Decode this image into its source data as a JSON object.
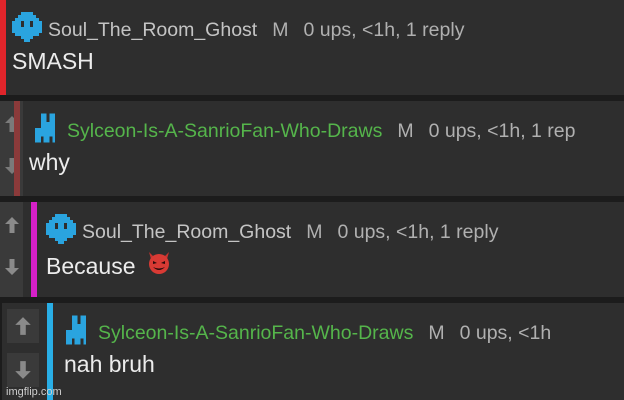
{
  "comments": [
    {
      "user": "Soul_The_Room_Ghost",
      "user_color": "#c4c4c4",
      "mod": "M",
      "meta": "0 ups, <1h, 1 reply",
      "text": "SMASH",
      "bar_color": "#e0252b",
      "avatar": "space-invader-icon"
    },
    {
      "user": "Sylceon-Is-A-SanrioFan-Who-Draws",
      "user_color": "#55b54b",
      "mod": "M",
      "meta": "0 ups, <1h, 1 rep",
      "text": "why",
      "bar_color": "#8b3a3a",
      "avatar": "pixel-creature-icon"
    },
    {
      "user": "Soul_The_Room_Ghost",
      "user_color": "#c4c4c4",
      "mod": "M",
      "meta": "0 ups, <1h, 1 reply",
      "text": "Because",
      "bar_color": "#d520c8",
      "avatar": "space-invader-icon",
      "emoji": "smiling-devil-emoji"
    },
    {
      "user": "Sylceon-Is-A-SanrioFan-Who-Draws",
      "user_color": "#55b54b",
      "mod": "M",
      "meta": "0 ups, <1h",
      "text": "nah bruh",
      "bar_color": "#29aee6",
      "avatar": "pixel-creature-icon"
    }
  ],
  "watermark": "imgflip.com"
}
